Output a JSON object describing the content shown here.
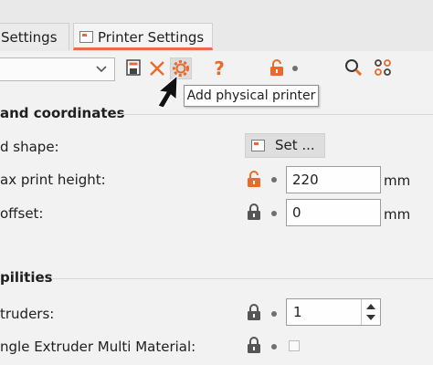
{
  "tabs": [
    {
      "label": "Settings",
      "active": false
    },
    {
      "label": "Printer Settings",
      "active": true
    }
  ],
  "toolbar": {
    "preset_value": "",
    "save_icon": "save-icon",
    "delete_icon": "delete-x-icon",
    "add_printer_icon": "gear-icon",
    "help_icon": "question-icon",
    "search_icon": "search-icon",
    "compare_icon": "compare-icon"
  },
  "tooltip": {
    "text": "Add physical printer"
  },
  "sections": {
    "bed": "and coordinates",
    "capabilities": "pilities"
  },
  "rows": {
    "bed_shape": {
      "label": "d shape:",
      "button": "Set ..."
    },
    "max_print_height": {
      "label": "ax print height:",
      "value": "220",
      "unit": "mm"
    },
    "z_offset": {
      "label": "offset:",
      "value": "0",
      "unit": "mm"
    },
    "extruders": {
      "label": "truders:",
      "value": "1"
    },
    "single_extruder_mm": {
      "label": "ngle Extruder Multi Material:",
      "checked": false
    }
  },
  "colors": {
    "accent_orange": "#ea6a2a",
    "lock_gray": "#555555"
  }
}
